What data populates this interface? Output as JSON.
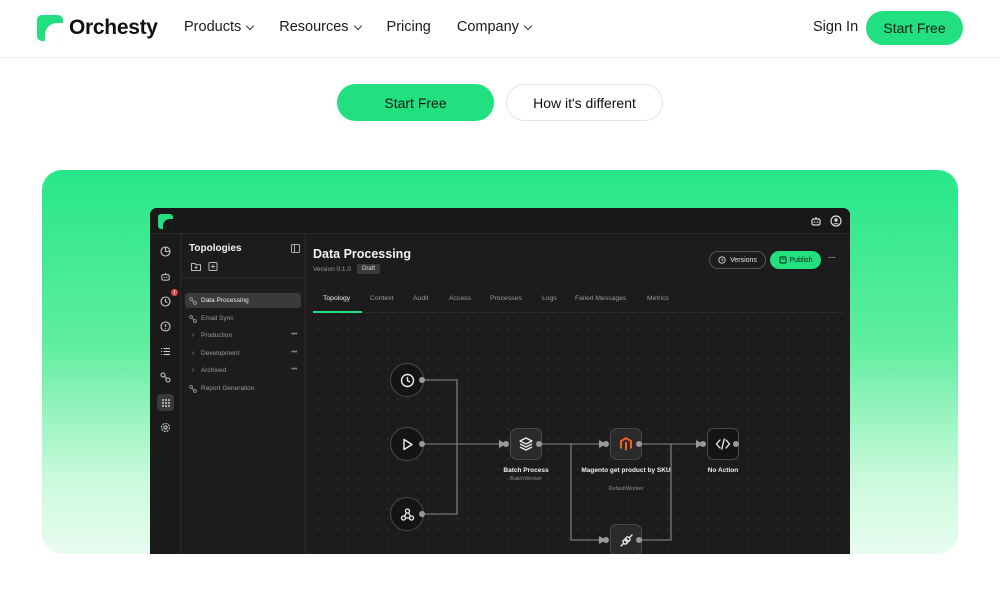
{
  "nav": {
    "brand": "Orchesty",
    "menu": [
      {
        "label": "Products",
        "has_dropdown": true
      },
      {
        "label": "Resources",
        "has_dropdown": true
      },
      {
        "label": "Pricing",
        "has_dropdown": false
      },
      {
        "label": "Company",
        "has_dropdown": true
      }
    ],
    "sign_in": "Sign In",
    "cta": "Start Free"
  },
  "hero": {
    "primary_cta": "Start Free",
    "secondary_cta": "How it's different"
  },
  "colors": {
    "accent": "#22e07f",
    "app_bg": "#1c1c1c",
    "badge": "#e5484d"
  },
  "app": {
    "top_icons": [
      "bot-icon",
      "user-circle-icon"
    ],
    "rail_icons": [
      "dashboard-icon",
      "bot-icon",
      "clock-icon",
      "alert-icon",
      "list-icon",
      "topology-icon",
      "grid-icon",
      "gear-icon"
    ],
    "rail_active": "grid-icon",
    "rail_badge": "!",
    "sidebar": {
      "title": "Topologies",
      "items": [
        {
          "label": "Data Processing",
          "kind": "topology",
          "selected": true
        },
        {
          "label": "Email Sync",
          "kind": "topology",
          "selected": false
        },
        {
          "label": "Production",
          "kind": "folder",
          "selected": false
        },
        {
          "label": "Development",
          "kind": "folder",
          "selected": false
        },
        {
          "label": "Archived",
          "kind": "folder",
          "selected": false
        },
        {
          "label": "Report Generation",
          "kind": "topology",
          "selected": false
        }
      ]
    },
    "main": {
      "title": "Data Processing",
      "version": "Version 0.1.0",
      "status": "Draft",
      "versions_button": "Versions",
      "publish_button": "Publish",
      "tabs": [
        "Topology",
        "Context",
        "Audit",
        "Access",
        "Processes",
        "Logs",
        "Failed Messages",
        "Metrics"
      ],
      "active_tab": "Topology"
    },
    "nodes": {
      "cron": {
        "icon": "clock-icon"
      },
      "start": {
        "icon": "play-icon"
      },
      "webhook": {
        "icon": "webhook-icon"
      },
      "batch": {
        "icon": "layers-icon",
        "label": "Batch Process",
        "sub": "BatchWorker"
      },
      "magento": {
        "icon": "magento-icon",
        "label": "Magento get product by SKU",
        "sub": "DefaultWorker"
      },
      "noaction": {
        "icon": "code-icon",
        "label": "No Action"
      },
      "connector": {
        "icon": "plug-icon"
      }
    }
  }
}
